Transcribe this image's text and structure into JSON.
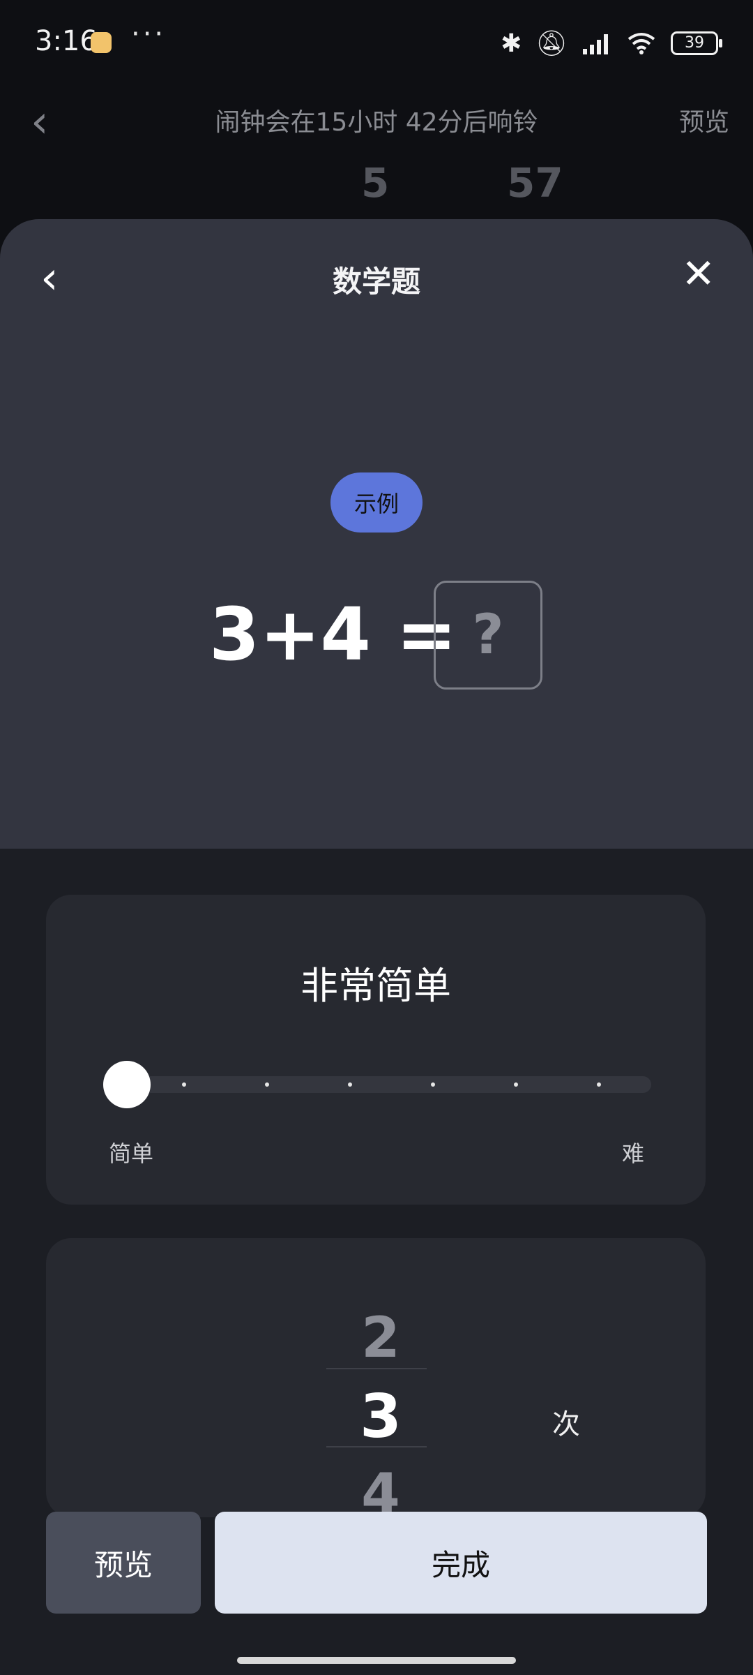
{
  "status_bar": {
    "time": "3:16",
    "more": "···",
    "battery": "39",
    "icons": [
      "app-icon",
      "bluetooth-icon",
      "bell-off-icon",
      "signal-hd-icon",
      "wifi-icon",
      "battery-icon"
    ]
  },
  "underlying": {
    "title": "闹钟会在15小时 42分后响铃",
    "preview": "预览",
    "time_hours_peek": "5",
    "time_minutes_peek": "57"
  },
  "sheet": {
    "title": "数学题",
    "example_badge": "示例",
    "equation": "3+4 =",
    "answer_placeholder": "?",
    "difficulty": {
      "label": "非常简单",
      "min_label": "简单",
      "max_label": "难",
      "level_index": 0,
      "steps": 7
    },
    "count_picker": {
      "prev": "2",
      "current": "3",
      "next": "4",
      "unit": "次"
    }
  },
  "buttons": {
    "preview": "预览",
    "done": "完成"
  },
  "colors": {
    "accent": "#5d76db",
    "sheet_top": "#333540",
    "card": "#272930",
    "done_bg": "#dde3f0"
  }
}
